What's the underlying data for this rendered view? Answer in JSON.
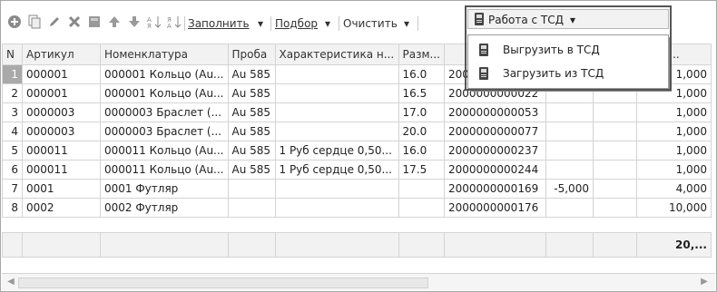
{
  "toolbar": {
    "fill_label": "Заполнить",
    "selection_label": "Подбор",
    "clear_label": "Очистить",
    "tsd_label": "Работа с ТСД",
    "tsd_dropdown_arrow": "▾"
  },
  "menu": {
    "items": [
      {
        "label": "Выгрузить в ТСД",
        "icon": "tsd-device-icon"
      },
      {
        "label": "Загрузить из ТСД",
        "icon": "tsd-device-icon"
      }
    ]
  },
  "table": {
    "headers": [
      "N",
      "Артикул",
      "Номенклатура",
      "Проба",
      "Характеристика н...",
      "Разм...",
      "",
      "",
      "",
      "Коли..."
    ],
    "rows": [
      {
        "n": "1",
        "article": "000001",
        "nomenclature": "000001 Кольцо (Au...",
        "probe": "Au 585",
        "char": "",
        "size": "16.0",
        "barcode": "2000000000015",
        "col8": "",
        "col9": "",
        "qty": "1,000"
      },
      {
        "n": "2",
        "article": "000001",
        "nomenclature": "000001 Кольцо (Au...",
        "probe": "Au 585",
        "char": "",
        "size": "16.5",
        "barcode": "2000000000022",
        "col8": "",
        "col9": "",
        "qty": "1,000"
      },
      {
        "n": "3",
        "article": "0000003",
        "nomenclature": "0000003 Браслет (...",
        "probe": "Au 585",
        "char": "",
        "size": "17.0",
        "barcode": "2000000000053",
        "col8": "",
        "col9": "",
        "qty": "1,000"
      },
      {
        "n": "4",
        "article": "0000003",
        "nomenclature": "0000003 Браслет (...",
        "probe": "Au 585",
        "char": "",
        "size": "20.0",
        "barcode": "2000000000077",
        "col8": "",
        "col9": "",
        "qty": "1,000"
      },
      {
        "n": "5",
        "article": "000011",
        "nomenclature": "000011 Кольцо (Au...",
        "probe": "Au 585",
        "char": "1 Руб сердце 0,50...",
        "size": "16.0",
        "barcode": "2000000000237",
        "col8": "",
        "col9": "",
        "qty": "1,000"
      },
      {
        "n": "6",
        "article": "000011",
        "nomenclature": "000011 Кольцо (Au...",
        "probe": "Au 585",
        "char": "1 Руб сердце 0,50...",
        "size": "17.5",
        "barcode": "2000000000244",
        "col8": "",
        "col9": "",
        "qty": "1,000"
      },
      {
        "n": "7",
        "article": "0001",
        "nomenclature": "0001 Футляр",
        "probe": "",
        "char": "",
        "size": "",
        "barcode": "2000000000169",
        "col8": "-5,000",
        "col9": "",
        "qty": "4,000"
      },
      {
        "n": "8",
        "article": "0002",
        "nomenclature": "0002 Футляр",
        "probe": "",
        "char": "",
        "size": "",
        "barcode": "2000000000176",
        "col8": "",
        "col9": "",
        "qty": "10,000"
      }
    ],
    "total_qty": "20,..."
  }
}
